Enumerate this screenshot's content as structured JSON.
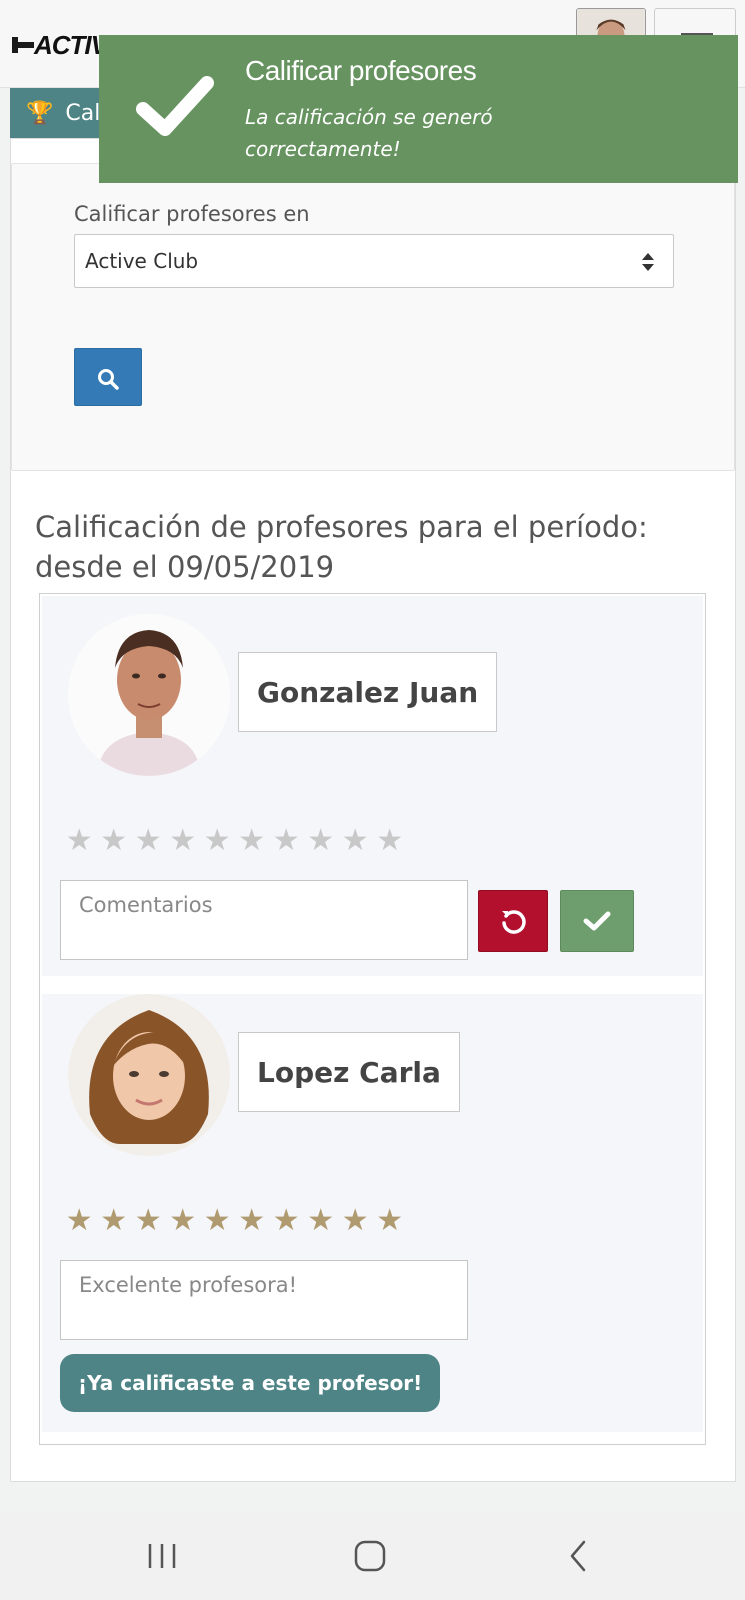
{
  "header": {
    "logo_text": "ACTIVE CLUB",
    "page_title": "Calificar profesores"
  },
  "toast": {
    "title": "Calificar profesores",
    "message": "La calificación se generó correctamente!",
    "color": "#66935f"
  },
  "search": {
    "label": "Calificar profesores en",
    "selected": "Active Club",
    "button_icon": "search-icon",
    "button_color": "#337ab7"
  },
  "period_text": "Calificación de profesores para el período: desde el 09/05/2019",
  "teachers": [
    {
      "name": "Gonzalez Juan",
      "rating": 0,
      "max_rating": 10,
      "comment_placeholder": "Comentarios",
      "comment_value": "",
      "actions": [
        "reset-icon",
        "check-icon"
      ]
    },
    {
      "name": "Lopez Carla",
      "rating": 10,
      "max_rating": 10,
      "comment_value": "Excelente profesora!",
      "status": "¡Ya calificaste a este profesor!"
    }
  ],
  "colors": {
    "accent_teal": "#4e8486",
    "star_on": "#b09b70",
    "star_off": "#c8c8c8",
    "danger": "#b3102d",
    "success": "#6e9e6d"
  },
  "system_nav": [
    "recent-apps-icon",
    "home-icon",
    "back-icon"
  ]
}
